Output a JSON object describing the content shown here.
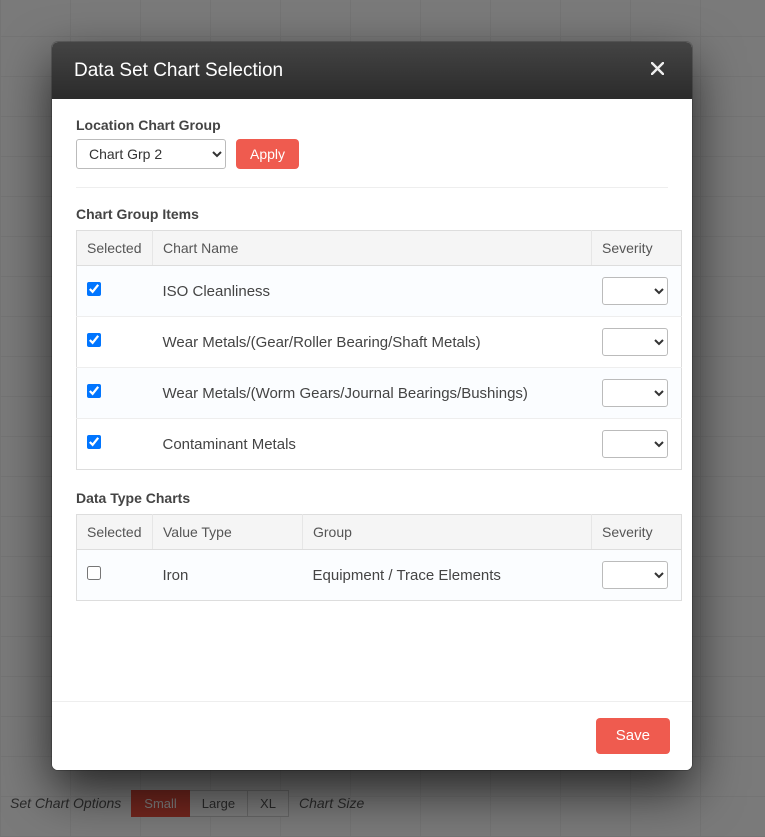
{
  "modal": {
    "title": "Data Set Chart Selection",
    "close_aria": "Close"
  },
  "location_group": {
    "label": "Location Chart Group",
    "selected": "Chart Grp 2",
    "apply_label": "Apply"
  },
  "chart_group_items": {
    "title": "Chart Group Items",
    "headers": {
      "selected": "Selected",
      "chart_name": "Chart Name",
      "severity": "Severity"
    },
    "rows": [
      {
        "selected": true,
        "name": "ISO Cleanliness",
        "severity": ""
      },
      {
        "selected": true,
        "name": "Wear Metals/(Gear/Roller Bearing/Shaft Metals)",
        "severity": ""
      },
      {
        "selected": true,
        "name": "Wear Metals/(Worm Gears/Journal Bearings/Bushings)",
        "severity": ""
      },
      {
        "selected": true,
        "name": "Contaminant Metals",
        "severity": ""
      }
    ]
  },
  "data_type_charts": {
    "title": "Data Type Charts",
    "headers": {
      "selected": "Selected",
      "value_type": "Value Type",
      "group": "Group",
      "severity": "Severity"
    },
    "rows": [
      {
        "selected": false,
        "value_type": "Iron",
        "group": "Equipment / Trace Elements",
        "severity": ""
      }
    ]
  },
  "footer": {
    "save_label": "Save"
  },
  "bottom_bar": {
    "options_label": "Set Chart Options",
    "sizes": {
      "small": "Small",
      "large": "Large",
      "xl": "XL"
    },
    "active_size": "small",
    "size_label": "Chart Size"
  }
}
